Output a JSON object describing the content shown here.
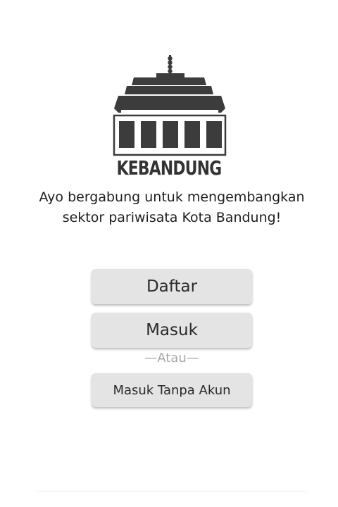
{
  "brand": {
    "name": "KEBANDUNG"
  },
  "tagline": "Ayo bergabung untuk mengembangkan sektor pariwisata Kota Bandung!",
  "buttons": {
    "register_label": "Daftar",
    "login_label": "Masuk",
    "guest_label": "Masuk Tanpa Akun"
  },
  "divider_label": "—Atau—",
  "colors": {
    "logo": "#3c3c3c",
    "button_bg": "#e4e4e4",
    "divider_text": "#a8a8a8"
  }
}
